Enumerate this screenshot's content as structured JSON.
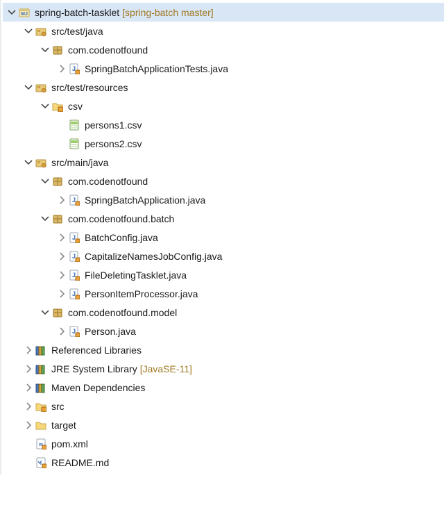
{
  "project": {
    "name": "spring-batch-tasklet",
    "decorator": "[spring-batch master]"
  },
  "srcTestJava": {
    "label": "src/test/java",
    "pkg": {
      "label": "com.codenotfound",
      "files": [
        "SpringBatchApplicationTests.java"
      ]
    }
  },
  "srcTestResources": {
    "label": "src/test/resources",
    "folder": {
      "label": "csv",
      "files": [
        "persons1.csv",
        "persons2.csv"
      ]
    }
  },
  "srcMainJava": {
    "label": "src/main/java",
    "packages": [
      {
        "label": "com.codenotfound",
        "files": [
          "SpringBatchApplication.java"
        ]
      },
      {
        "label": "com.codenotfound.batch",
        "files": [
          "BatchConfig.java",
          "CapitalizeNamesJobConfig.java",
          "FileDeletingTasklet.java",
          "PersonItemProcessor.java"
        ]
      },
      {
        "label": "com.codenotfound.model",
        "files": [
          "Person.java"
        ]
      }
    ]
  },
  "libraries": {
    "referenced": "Referenced Libraries",
    "jre": {
      "label": "JRE System Library",
      "decorator": "[JavaSE-11]"
    },
    "maven": "Maven Dependencies"
  },
  "folders": {
    "src": "src",
    "target": "target"
  },
  "files": {
    "pom": "pom.xml",
    "readme": "README.md"
  }
}
